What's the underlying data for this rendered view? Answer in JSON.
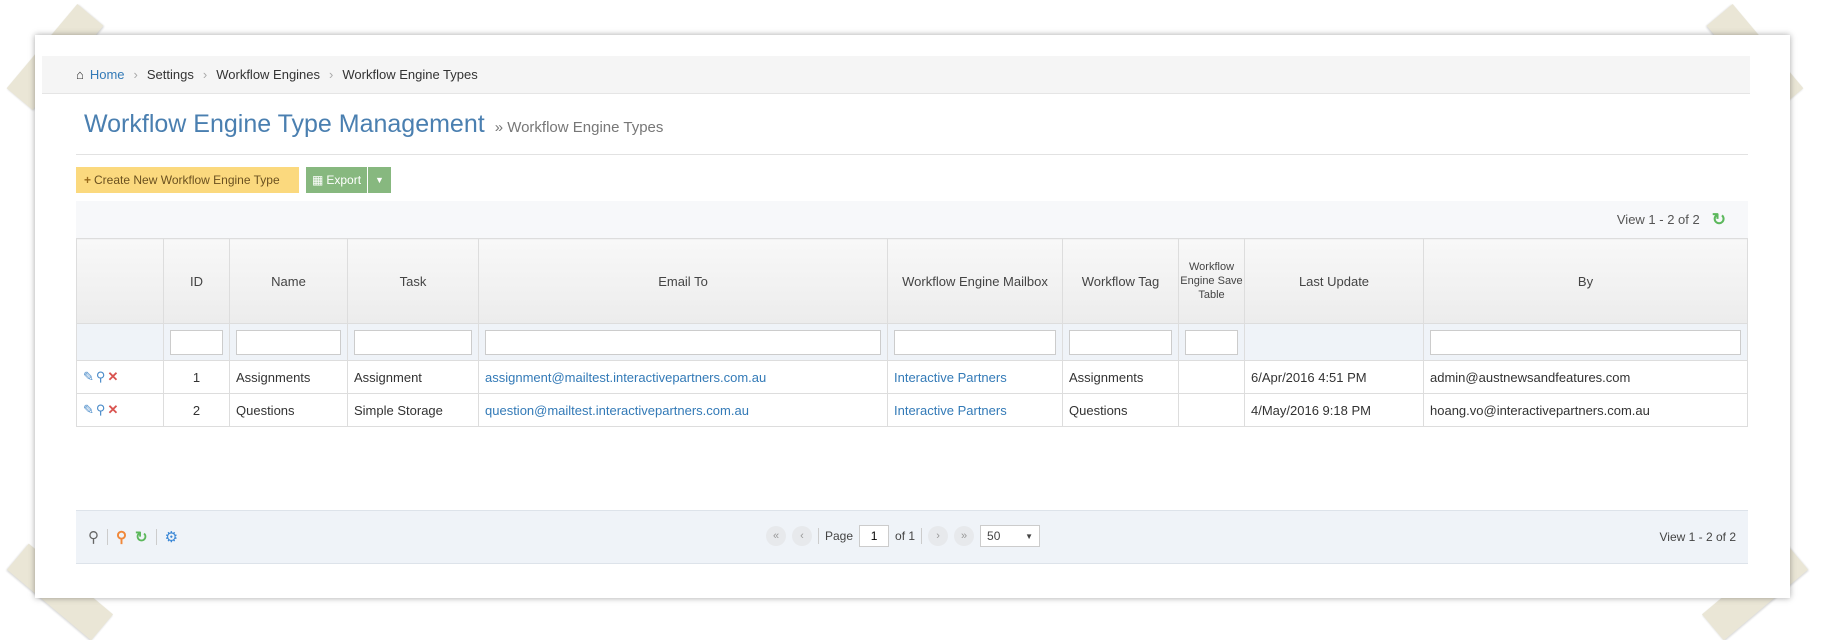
{
  "breadcrumb": {
    "home": "Home",
    "items": [
      "Settings",
      "Workflow Engines",
      "Workflow Engine Types"
    ]
  },
  "page": {
    "title": "Workflow Engine Type Management",
    "subtitle": "» Workflow Engine Types"
  },
  "actions": {
    "create": "Create New Workflow Engine Type",
    "export": "Export"
  },
  "grid": {
    "view_text": "View 1 - 2 of 2",
    "columns": [
      "",
      "ID",
      "Name",
      "Task",
      "Email To",
      "Workflow Engine Mailbox",
      "Workflow Tag",
      "Workflow Engine Save Table",
      "Last Update",
      "By"
    ],
    "rows": [
      {
        "id": "1",
        "name": "Assignments",
        "task": "Assignment",
        "email": "assignment@mailtest.interactivepartners.com.au",
        "mailbox": "Interactive Partners",
        "tag": "Assignments",
        "save_table": "",
        "last_update": "6/Apr/2016 4:51 PM",
        "by": "admin@austnewsandfeatures.com"
      },
      {
        "id": "2",
        "name": "Questions",
        "task": "Simple Storage",
        "email": "question@mailtest.interactivepartners.com.au",
        "mailbox": "Interactive Partners",
        "tag": "Questions",
        "save_table": "",
        "last_update": "4/May/2016 9:18 PM",
        "by": "hoang.vo@interactivepartners.com.au"
      }
    ]
  },
  "pager": {
    "page_label": "Page",
    "page": "1",
    "of_label": "of 1",
    "page_size": "50",
    "view_text": "View 1 - 2 of 2"
  }
}
